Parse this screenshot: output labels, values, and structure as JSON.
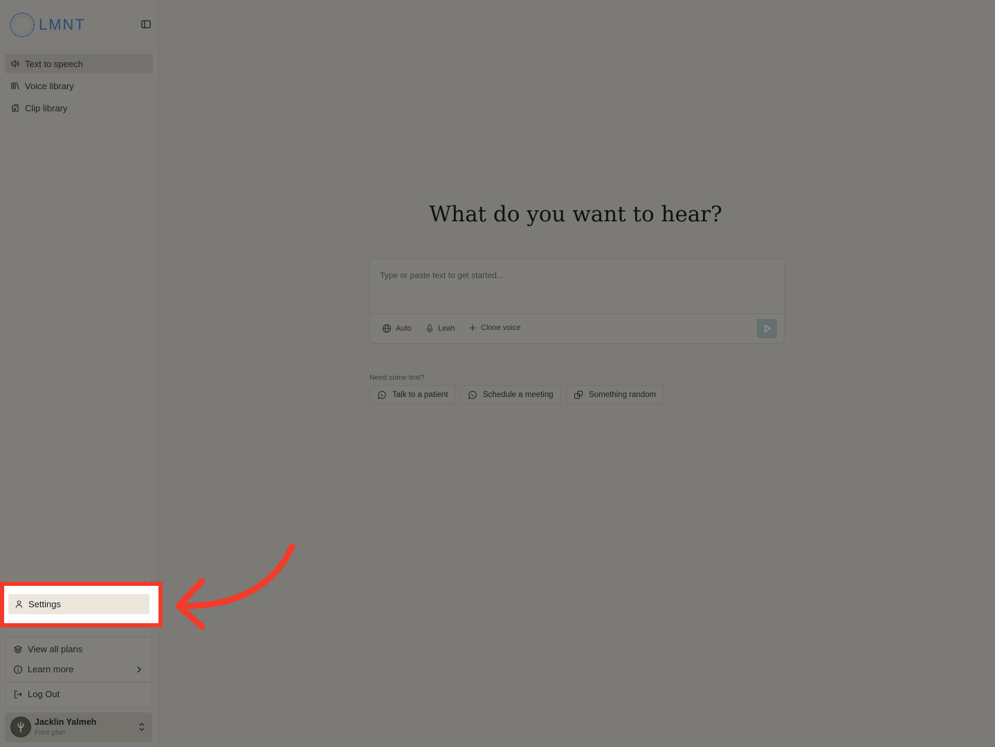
{
  "app": {
    "logo_text": "LMNT"
  },
  "sidebar": {
    "items": [
      {
        "label": "Text to speech",
        "icon": "speaker-icon",
        "active": true
      },
      {
        "label": "Voice library",
        "icon": "library-icon",
        "active": false
      },
      {
        "label": "Clip library",
        "icon": "clip-icon",
        "active": false
      }
    ]
  },
  "main": {
    "title": "What do you want to hear?",
    "editor_placeholder": "Type or paste text to get started...",
    "chips": {
      "language": "Auto",
      "voice": "Leah",
      "clone": "Clone voice"
    },
    "need_text_label": "Need some text?",
    "suggestions": [
      "Talk to a patient",
      "Schedule a meeting",
      "Something random"
    ]
  },
  "user_menu": {
    "settings": "Settings",
    "view_all_plans": "View all plans",
    "learn_more": "Learn more",
    "log_out": "Log Out"
  },
  "user": {
    "name": "Jacklin Yalmeh",
    "plan": "Free plan"
  },
  "colors": {
    "highlight": "#f33b2a",
    "brand": "#2d4a72"
  }
}
